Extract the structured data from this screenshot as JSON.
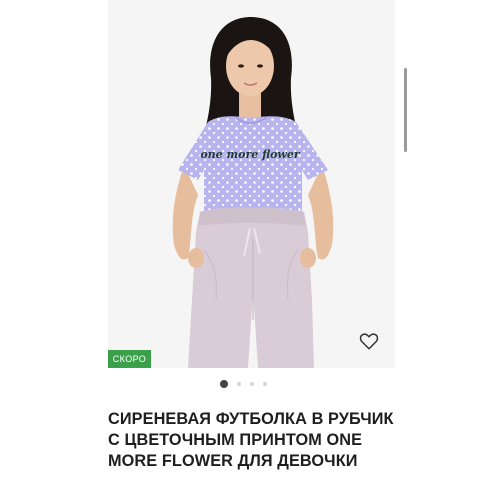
{
  "product": {
    "image": {
      "print_text": "one more flower",
      "alt": "СИРЕНЕВАЯ ФУТБОЛКА В РУБЧИК С ЦВЕТОЧНЫМ ПРИНТОМ ONE MORE FLOWER ДЛЯ ДЕВОЧКИ"
    },
    "badge": "СКОРО",
    "title": "СИРЕНЕВАЯ ФУТБОЛКА В РУБЧИК С ЦВЕТОЧНЫМ ПРИНТОМ ONE MORE FLOWER ДЛЯ ДЕВОЧКИ",
    "favorite_icon": "heart-outline-icon",
    "gallery": {
      "total": 4,
      "active": 1
    }
  },
  "colors": {
    "badge": "#3aa14a",
    "shirt": "#b8b4ee",
    "pants": "#d9ccd6"
  }
}
